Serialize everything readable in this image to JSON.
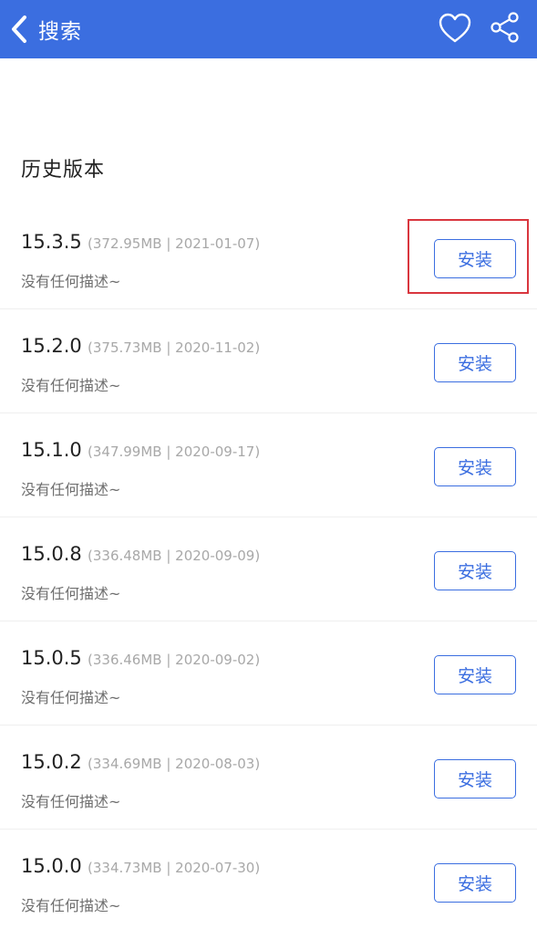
{
  "navbar": {
    "title": "搜索",
    "back_icon": "chevron-left-icon",
    "favorite_icon": "heart-icon",
    "share_icon": "share-icon",
    "background_color": "#3b6ee0"
  },
  "section": {
    "title": "历史版本"
  },
  "versions": [
    {
      "version": "15.3.5",
      "meta": "(372.95MB | 2021-01-07)",
      "description": "没有任何描述~",
      "button_label": "安装",
      "highlighted": true
    },
    {
      "version": "15.2.0",
      "meta": "(375.73MB | 2020-11-02)",
      "description": "没有任何描述~",
      "button_label": "安装",
      "highlighted": false
    },
    {
      "version": "15.1.0",
      "meta": "(347.99MB | 2020-09-17)",
      "description": "没有任何描述~",
      "button_label": "安装",
      "highlighted": false
    },
    {
      "version": "15.0.8",
      "meta": "(336.48MB | 2020-09-09)",
      "description": "没有任何描述~",
      "button_label": "安装",
      "highlighted": false
    },
    {
      "version": "15.0.5",
      "meta": "(336.46MB | 2020-09-02)",
      "description": "没有任何描述~",
      "button_label": "安装",
      "highlighted": false
    },
    {
      "version": "15.0.2",
      "meta": "(334.69MB | 2020-08-03)",
      "description": "没有任何描述~",
      "button_label": "安装",
      "highlighted": false
    },
    {
      "version": "15.0.0",
      "meta": "(334.73MB | 2020-07-30)",
      "description": "没有任何描述~",
      "button_label": "安装",
      "highlighted": false
    }
  ],
  "colors": {
    "accent": "#3b6ee0",
    "highlight": "#d9363e"
  }
}
